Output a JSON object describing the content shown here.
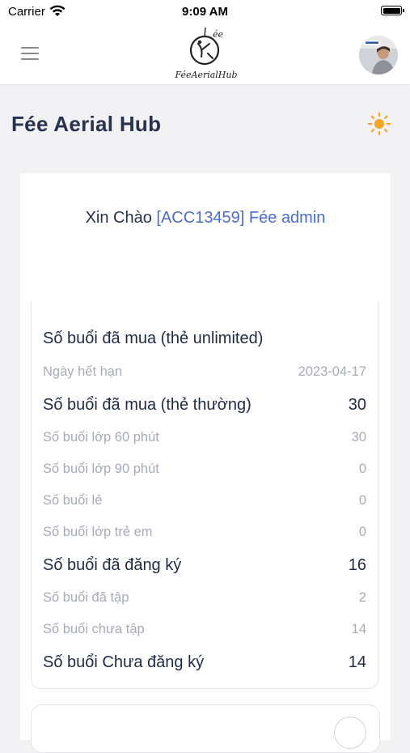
{
  "status_bar": {
    "carrier": "Carrier",
    "time": "9:09 AM"
  },
  "header": {
    "logo_text": "FéeAerialHub"
  },
  "page": {
    "title": "Fée Aerial Hub",
    "accent_color": "#f5a524"
  },
  "greeting": {
    "prefix": "Xin Chào",
    "account": "[ACC13459] Fée admin"
  },
  "stats": [
    {
      "label": "Số buổi đã mua (thẻ unlimited)",
      "value": "",
      "kind": "main"
    },
    {
      "label": "Ngày hết hạn",
      "value": "2023-04-17",
      "kind": "sub"
    },
    {
      "label": "Số buổi đã mua (thẻ thường)",
      "value": "30",
      "kind": "main"
    },
    {
      "label": "Số buổi lớp 60 phút",
      "value": "30",
      "kind": "sub"
    },
    {
      "label": "Số buổi lớp 90 phút",
      "value": "0",
      "kind": "sub"
    },
    {
      "label": "Số buổi lẻ",
      "value": "0",
      "kind": "sub"
    },
    {
      "label": "Số buổi lớp trẻ em",
      "value": "0",
      "kind": "sub"
    },
    {
      "label": "Số buổi đã đăng ký",
      "value": "16",
      "kind": "main"
    },
    {
      "label": "Số buổi đã tập",
      "value": "2",
      "kind": "sub"
    },
    {
      "label": "Số buổi chưa tập",
      "value": "14",
      "kind": "sub"
    },
    {
      "label": "Số buổi Chưa đăng ký",
      "value": "14",
      "kind": "main"
    }
  ]
}
